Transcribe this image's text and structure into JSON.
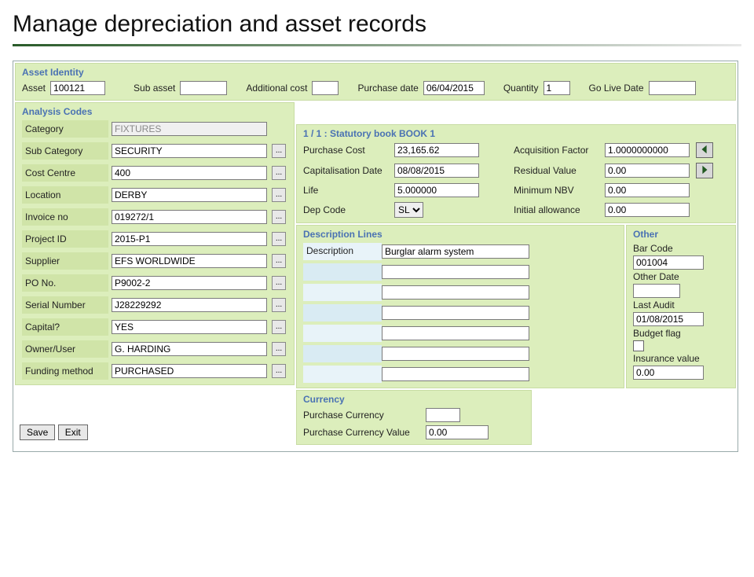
{
  "page": {
    "title": "Manage depreciation and asset records"
  },
  "identity": {
    "panel_title": "Asset Identity",
    "asset_label": "Asset",
    "asset": "100121",
    "sub_asset_label": "Sub asset",
    "sub_asset": "",
    "additional_cost_label": "Additional cost",
    "additional_cost": "",
    "purchase_date_label": "Purchase date",
    "purchase_date": "06/04/2015",
    "quantity_label": "Quantity",
    "quantity": "1",
    "go_live_label": "Go Live Date",
    "go_live": ""
  },
  "analysis": {
    "panel_title": "Analysis Codes",
    "rows": [
      {
        "label": "Category",
        "value": "FIXTURES",
        "lookup": false,
        "readonly": true
      },
      {
        "label": "Sub Category",
        "value": "SECURITY",
        "lookup": true
      },
      {
        "label": "Cost Centre",
        "value": "400",
        "lookup": true
      },
      {
        "label": "Location",
        "value": "DERBY",
        "lookup": true
      },
      {
        "label": "Invoice no",
        "value": "019272/1",
        "lookup": true
      },
      {
        "label": "Project ID",
        "value": "2015-P1",
        "lookup": true
      },
      {
        "label": "Supplier",
        "value": "EFS WORLDWIDE",
        "lookup": true
      },
      {
        "label": "PO No.",
        "value": "P9002-2",
        "lookup": true
      },
      {
        "label": "Serial Number",
        "value": "J28229292",
        "lookup": true
      },
      {
        "label": "Capital?",
        "value": "YES",
        "lookup": true
      },
      {
        "label": "Owner/User",
        "value": "G. HARDING",
        "lookup": true
      },
      {
        "label": "Funding method",
        "value": "PURCHASED",
        "lookup": true
      }
    ]
  },
  "book": {
    "panel_title": "1 / 1 : Statutory book BOOK 1",
    "purchase_cost_label": "Purchase Cost",
    "purchase_cost": "23,165.62",
    "acq_factor_label": "Acquisition Factor",
    "acq_factor": "1.0000000000",
    "cap_date_label": "Capitalisation Date",
    "cap_date": "08/08/2015",
    "residual_label": "Residual Value",
    "residual": "0.00",
    "life_label": "Life",
    "life": "5.000000",
    "min_nbv_label": "Minimum NBV",
    "min_nbv": "0.00",
    "dep_code_label": "Dep Code",
    "dep_code": "SL",
    "init_allow_label": "Initial allowance",
    "init_allow": "0.00"
  },
  "description": {
    "panel_title": "Description Lines",
    "label": "Description",
    "lines": [
      "Burglar alarm system",
      "",
      "",
      "",
      "",
      "",
      ""
    ]
  },
  "other": {
    "panel_title": "Other",
    "bar_code_label": "Bar Code",
    "bar_code": "001004",
    "other_date_label": "Other Date",
    "other_date": "",
    "last_audit_label": "Last Audit",
    "last_audit": "01/08/2015",
    "budget_flag_label": "Budget flag",
    "budget_flag": false,
    "insurance_label": "Insurance value",
    "insurance": "0.00"
  },
  "currency": {
    "panel_title": "Currency",
    "purchase_currency_label": "Purchase Currency",
    "purchase_currency": "",
    "purchase_currency_value_label": "Purchase Currency Value",
    "purchase_currency_value": "0.00"
  },
  "actions": {
    "save": "Save",
    "exit": "Exit",
    "ellipsis": "..."
  }
}
